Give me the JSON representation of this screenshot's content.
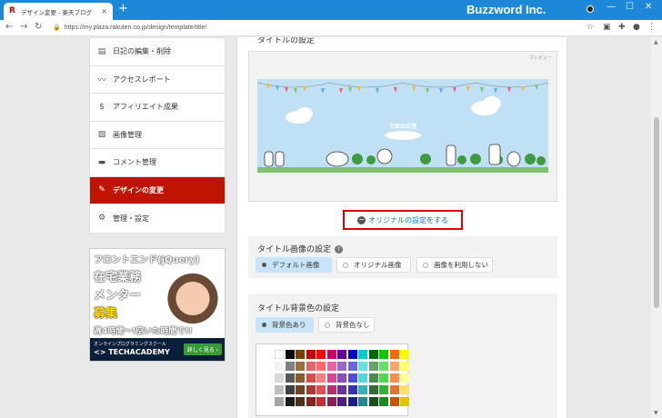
{
  "browser": {
    "tab_title": "デザイン変更 - 楽天ブログ",
    "tab_close": "×",
    "new_tab": "+",
    "brand": "Buzzword Inc.",
    "url": "https://my.plaza.rakuten.co.jp/design/template/title/",
    "win_min": "—",
    "win_max": "☐",
    "win_close": "✕"
  },
  "sidebar": {
    "items": [
      {
        "icon": "edit-icon",
        "label": "日記の編集・削除"
      },
      {
        "icon": "chart-line-icon",
        "label": "アクセスレポート"
      },
      {
        "icon": "money-bag-icon",
        "label": "アフィリエイト成果"
      },
      {
        "icon": "image-icon",
        "label": "画像管理"
      },
      {
        "icon": "comment-icon",
        "label": "コメント管理"
      },
      {
        "icon": "palette-icon",
        "label": "デザインの変更",
        "active": true
      },
      {
        "icon": "gear-icon",
        "label": "管理・設定"
      }
    ]
  },
  "ad": {
    "line1": "フロントエンド(jQuery)",
    "line2": "在宅業務",
    "line3": "メンター",
    "line4": "募集",
    "line5": "週4時間〜!空いた時間で!!",
    "school": "オンラインプログラミングスクール",
    "logo": "<> TECHACADEMY",
    "cta": "詳しく見る ›"
  },
  "main": {
    "title_setting_heading": "タイトルの設定",
    "preview_label": "プレビュー",
    "banner_title": "太郎の日常",
    "original_button": "オリジナルの設定をする",
    "title_image_heading": "タイトル画像の設定",
    "help": "?",
    "image_options": [
      "デフォルト画像",
      "オリジナル画像",
      "画像を利用しない"
    ],
    "bg_heading": "タイトル背景色の設定",
    "bg_options": [
      "背景色あり",
      "背景色なし"
    ]
  },
  "colors": {
    "accent_red": "#bf1400",
    "tabbar_blue": "#1e88d8",
    "palette": [
      [
        "#ffffff",
        "#000000",
        "#7b3f00",
        "#cc0000",
        "#ff0000",
        "#cc0066",
        "#660099",
        "#0000cc",
        "#00cccc",
        "#006600",
        "#00cc00",
        "#ff6600",
        "#ffff00"
      ],
      [
        "#f2f2f2",
        "#808080",
        "#a0703c",
        "#e06666",
        "#ff6666",
        "#e066a3",
        "#9966cc",
        "#6666e0",
        "#66e0e0",
        "#66a366",
        "#66e066",
        "#ffa366",
        "#ffff66"
      ],
      [
        "#d9d9d9",
        "#595959",
        "#8a5a2b",
        "#d94c4c",
        "#f08080",
        "#d1478f",
        "#8a4dbf",
        "#4d4dd9",
        "#4dd9d9",
        "#4d8a4d",
        "#4dd94d",
        "#ff8c4d",
        "#ffff99"
      ],
      [
        "#bfbfbf",
        "#404040",
        "#6b4423",
        "#b33636",
        "#e05050",
        "#b3306f",
        "#6b339e",
        "#3333b3",
        "#33b3b3",
        "#336b33",
        "#33b333",
        "#e6732e",
        "#ffe066"
      ],
      [
        "#a6a6a6",
        "#1a1a1a",
        "#4d3019",
        "#8a2020",
        "#c03030",
        "#8a1f52",
        "#4d1f80",
        "#1f1f8a",
        "#1f8a8a",
        "#1f4d1f",
        "#1f8a1f",
        "#cc5200",
        "#e6c200"
      ]
    ]
  }
}
